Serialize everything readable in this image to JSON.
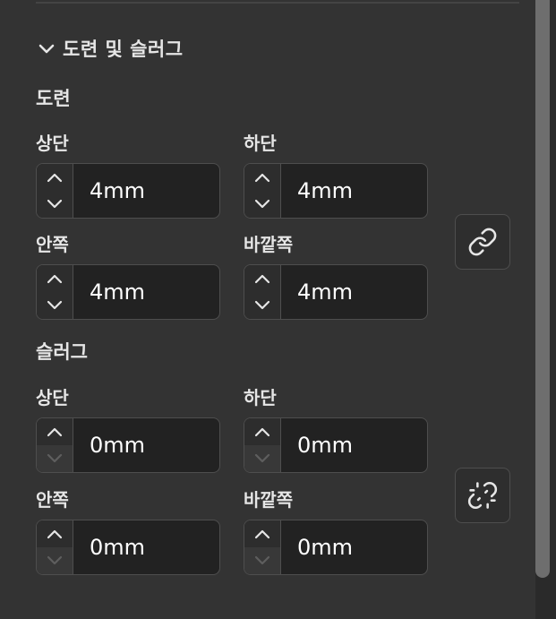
{
  "section": {
    "title": "도련 및 슬러그",
    "expanded": true,
    "icon": "chevron-down-icon"
  },
  "bleed": {
    "title": "도련",
    "top": {
      "label": "상단",
      "value": "4mm"
    },
    "bottom": {
      "label": "하단",
      "value": "4mm"
    },
    "inside": {
      "label": "안쪽",
      "value": "4mm"
    },
    "outside": {
      "label": "바깥쪽",
      "value": "4mm"
    },
    "link_icon": "link-icon",
    "linked": true
  },
  "slug": {
    "title": "슬러그",
    "top": {
      "label": "상단",
      "value": "0mm"
    },
    "bottom": {
      "label": "하단",
      "value": "0mm"
    },
    "inside": {
      "label": "안쪽",
      "value": "0mm"
    },
    "outside": {
      "label": "바깥쪽",
      "value": "0mm"
    },
    "link_icon": "unlink-icon",
    "linked": false
  },
  "colors": {
    "panel": "#333333",
    "field": "#222222",
    "border": "#4e4e4e",
    "text": "#e6e6e6"
  }
}
